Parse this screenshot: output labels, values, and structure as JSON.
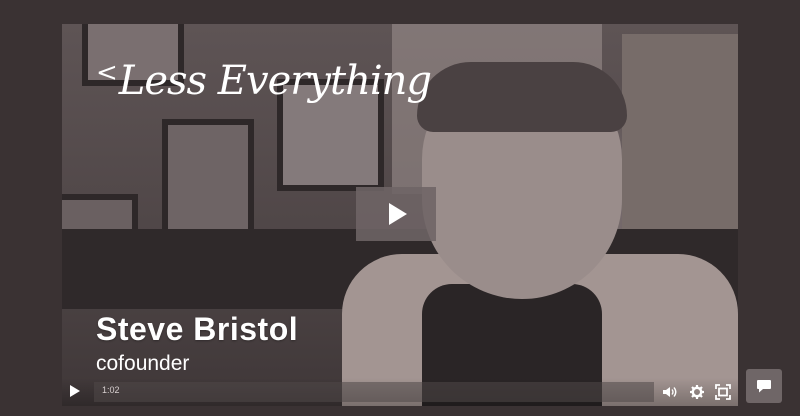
{
  "logo": {
    "caret": "<",
    "text": "Less Everything"
  },
  "person": {
    "name": "Steve Bristol",
    "role": "cofounder"
  },
  "player": {
    "time": "1:02",
    "progress": 0
  },
  "icons": {
    "play": "play-icon",
    "volume": "volume-icon",
    "settings": "gear-icon",
    "fullscreen": "fullscreen-icon",
    "chat": "chat-icon"
  },
  "colors": {
    "background": "#3a3233",
    "overlay": "#6e6465",
    "text": "#ffffff"
  }
}
